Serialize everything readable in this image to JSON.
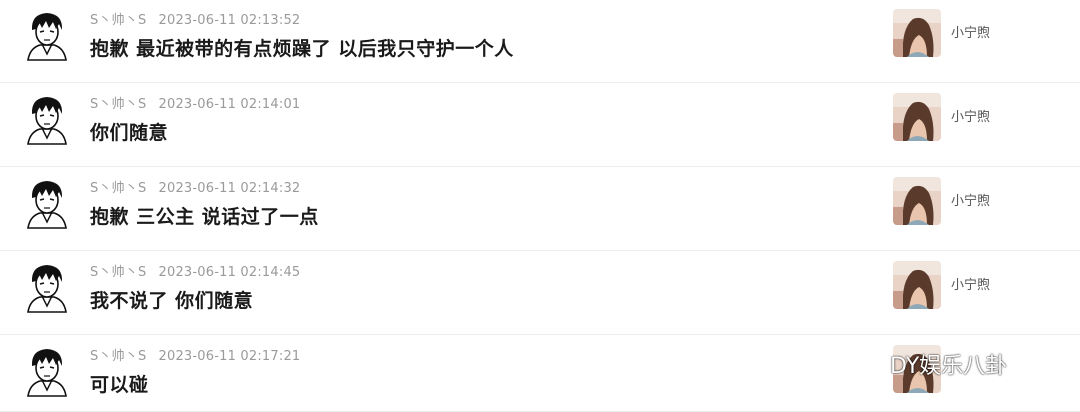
{
  "colors": {
    "meta_text": "#9a9a9a",
    "message_text": "#1a1a1a",
    "name_text": "#555555",
    "divider": "#ececec"
  },
  "messages": [
    {
      "sender": "S丶帅丶S",
      "time": "2023-06-11 02:13:52",
      "text": "抱歉  最近被带的有点烦躁了  以后我只守护一个人",
      "recipient": "小宁煦",
      "left_avatar_icon": "manga-boy-avatar-icon",
      "right_avatar_icon": "girl-photo-avatar-icon"
    },
    {
      "sender": "S丶帅丶S",
      "time": "2023-06-11 02:14:01",
      "text": "你们随意",
      "recipient": "小宁煦",
      "left_avatar_icon": "manga-boy-avatar-icon",
      "right_avatar_icon": "girl-photo-avatar-icon"
    },
    {
      "sender": "S丶帅丶S",
      "time": "2023-06-11 02:14:32",
      "text": "抱歉  三公主  说话过了一点",
      "recipient": "小宁煦",
      "left_avatar_icon": "manga-boy-avatar-icon",
      "right_avatar_icon": "girl-photo-avatar-icon"
    },
    {
      "sender": "S丶帅丶S",
      "time": "2023-06-11 02:14:45",
      "text": "我不说了  你们随意",
      "recipient": "小宁煦",
      "left_avatar_icon": "manga-boy-avatar-icon",
      "right_avatar_icon": "girl-photo-avatar-icon"
    },
    {
      "sender": "S丶帅丶S",
      "time": "2023-06-11 02:17:21",
      "text": "可以碰",
      "recipient": "",
      "left_avatar_icon": "manga-boy-avatar-icon",
      "right_avatar_icon": "girl-photo-avatar-icon"
    }
  ],
  "watermark": {
    "text": "DY娱乐八卦",
    "icon": "wechat-icon"
  }
}
